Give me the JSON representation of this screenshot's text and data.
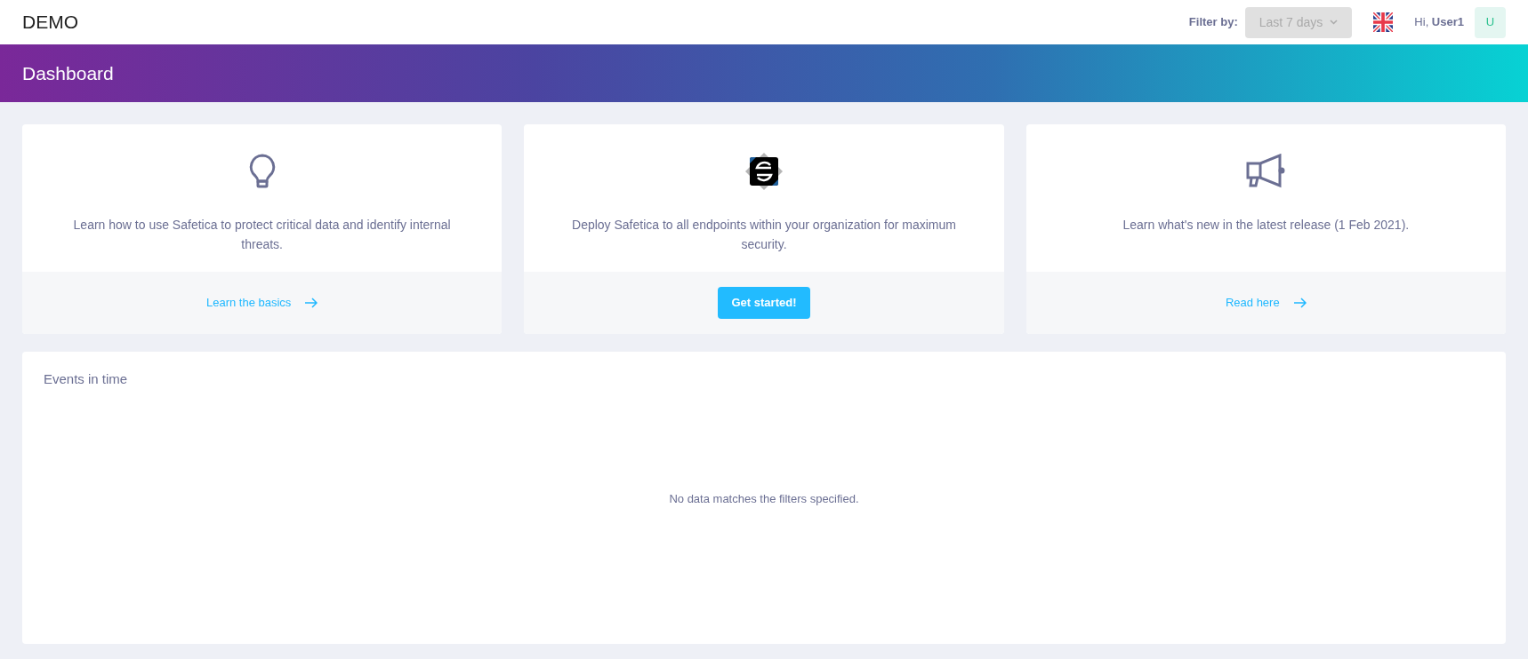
{
  "header": {
    "logo": "DEMO",
    "filter_label": "Filter by:",
    "filter_value": "Last 7 days",
    "greeting": "Hi, ",
    "user": "User1",
    "avatar": "U"
  },
  "banner": {
    "title": "Dashboard"
  },
  "cards": [
    {
      "text": "Learn how to use Safetica to protect critical data and identify internal threats.",
      "action": {
        "kind": "link",
        "label": "Learn the basics"
      }
    },
    {
      "text": "Deploy Safetica to all endpoints within your organization for maximum security.",
      "action": {
        "kind": "button",
        "label": "Get started!"
      }
    },
    {
      "text": "Learn what's new in the latest release (1 Feb 2021).",
      "action": {
        "kind": "link",
        "label": "Read here"
      }
    }
  ],
  "events": {
    "title": "Events in time",
    "empty_message": "No data matches the filters specified."
  }
}
